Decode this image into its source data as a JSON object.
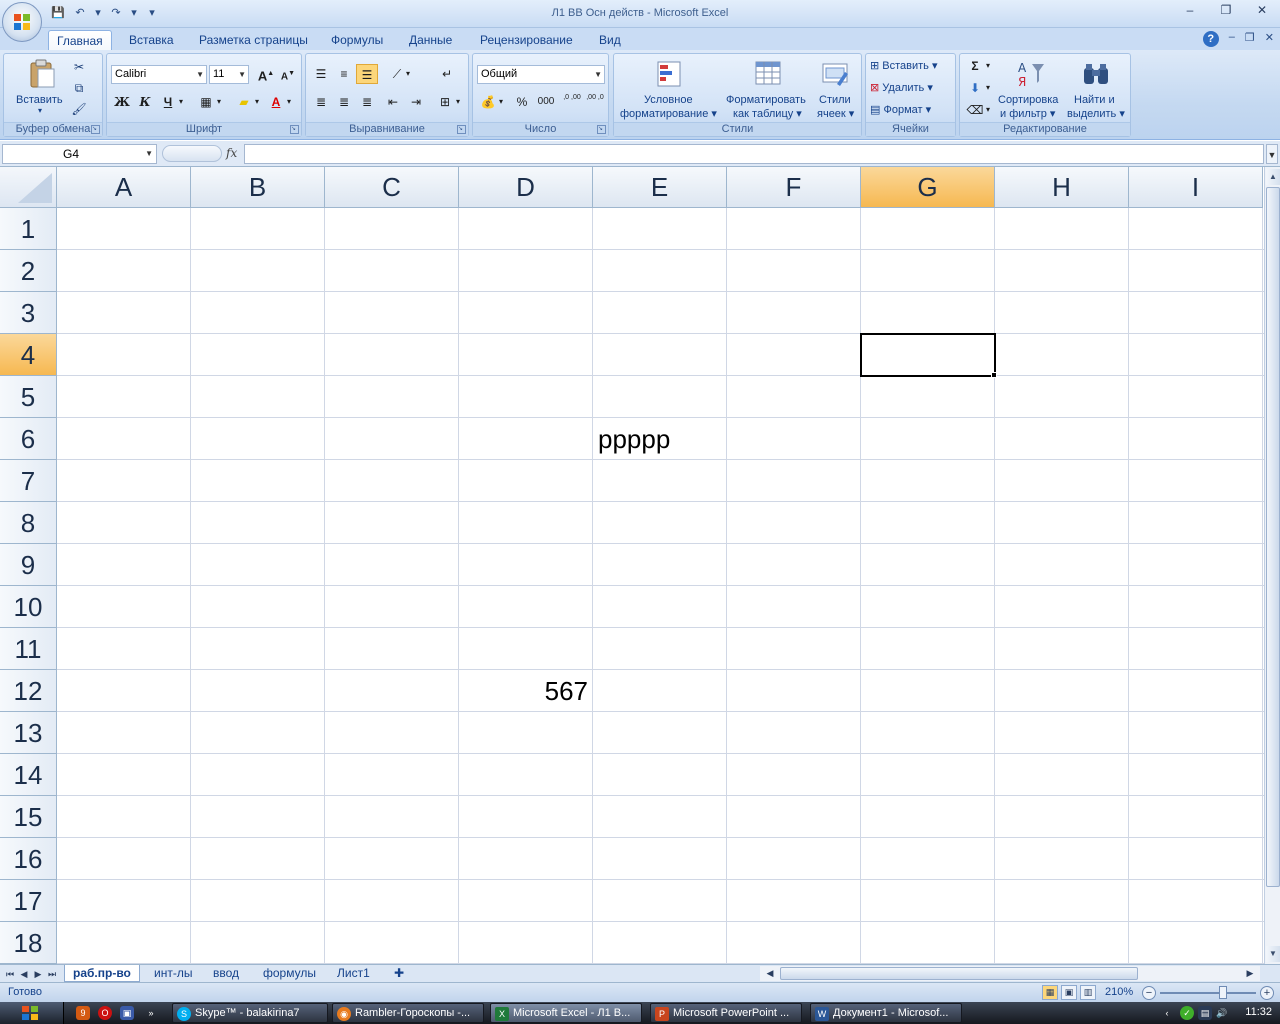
{
  "window": {
    "title": "Л1 ВВ Осн действ - Microsoft Excel",
    "controls": [
      "–",
      "❐",
      "✕"
    ],
    "doc_controls": [
      "–",
      "❐",
      "✕"
    ]
  },
  "qat": [
    "💾",
    "↶",
    "▾",
    "↷",
    "▾",
    "▾"
  ],
  "tabs": [
    {
      "label": "Главная",
      "active": true
    },
    {
      "label": "Вставка"
    },
    {
      "label": "Разметка страницы"
    },
    {
      "label": "Формулы"
    },
    {
      "label": "Данные"
    },
    {
      "label": "Рецензирование"
    },
    {
      "label": "Вид"
    }
  ],
  "ribbon": {
    "clipboard": {
      "label": "Буфер обмена",
      "paste": "Вставить"
    },
    "font": {
      "label": "Шрифт",
      "name": "Calibri",
      "size": "11",
      "bold": "Ж",
      "italic": "К",
      "underline": "Ч",
      "grow": "A",
      "shrink": "A",
      "fontcolor": "A"
    },
    "alignment": {
      "label": "Выравнивание"
    },
    "number": {
      "label": "Число",
      "format": "Общий",
      "percent": "%",
      "thousands": "000",
      "inc": ",0 ,00",
      "dec": ",00 ,0"
    },
    "styles": {
      "label": "Стили",
      "cond1": "Условное",
      "cond2": "форматирование",
      "table1": "Форматировать",
      "table2": "как таблицу",
      "cell1": "Стили",
      "cell2": "ячеек"
    },
    "cells": {
      "label": "Ячейки",
      "insert": "Вставить",
      "delete": "Удалить",
      "format": "Формат"
    },
    "editing": {
      "label": "Редактирование",
      "sigma": "Σ",
      "sort1": "Сортировка",
      "sort2": "и фильтр",
      "find1": "Найти и",
      "find2": "выделить"
    }
  },
  "formula_bar": {
    "name_box": "G4",
    "fx": "fx",
    "value": ""
  },
  "columns": [
    "A",
    "B",
    "C",
    "D",
    "E",
    "F",
    "G",
    "H",
    "I"
  ],
  "selected_column": "G",
  "rows": [
    "1",
    "2",
    "3",
    "4",
    "5",
    "6",
    "7",
    "8",
    "9",
    "10",
    "11",
    "12",
    "13",
    "14",
    "15",
    "16",
    "17",
    "18"
  ],
  "selected_row": "4",
  "cells": {
    "E6": "ppppp",
    "D12": "567"
  },
  "sheets": [
    {
      "label": "раб.пр-во",
      "active": true
    },
    {
      "label": "инт-лы"
    },
    {
      "label": "ввод"
    },
    {
      "label": "формулы"
    },
    {
      "label": "Лист1"
    }
  ],
  "status": {
    "text": "Готово",
    "zoom": "210%"
  },
  "taskbar": {
    "items": [
      {
        "label": "Skype™ - balakirina7",
        "color": "#00aff0",
        "icon": "S"
      },
      {
        "label": "Rambler-Гороскопы -...",
        "color": "#e87b1e",
        "icon": "◉"
      },
      {
        "label": "Microsoft Excel - Л1 В...",
        "color": "#1f7a3a",
        "icon": "X",
        "active": true
      },
      {
        "label": "Microsoft PowerPoint ...",
        "color": "#c8451e",
        "icon": "P"
      },
      {
        "label": "Документ1 - Microsof...",
        "color": "#2b5797",
        "icon": "W"
      }
    ],
    "clock": "11:32"
  }
}
